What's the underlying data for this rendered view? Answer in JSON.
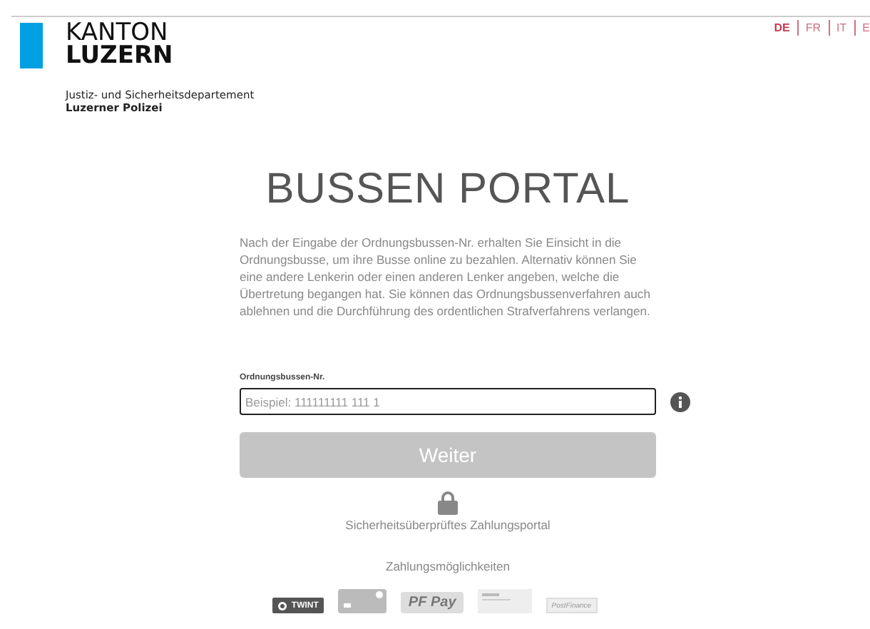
{
  "header": {
    "logo": {
      "line_1": "KANTON",
      "line_2": "LUZERN"
    },
    "department": "Justiz- und Sicherheitsdepartement",
    "unit": "Luzerner Polizei"
  },
  "languages": [
    {
      "label": "DE",
      "selected": true
    },
    {
      "label": "FR",
      "selected": false
    },
    {
      "label": "IT",
      "selected": false
    },
    {
      "label": "E",
      "selected": false
    }
  ],
  "title": "BUSSEN PORTAL",
  "intro": "Nach der Eingabe der Ordnungsbussen-Nr. erhalten Sie Einsicht in die Ordnungsbusse, um ihre Busse online zu bezahlen. Alternativ können Sie eine andere Lenkerin oder einen anderen Lenker angeben, welche die Übertretung begangen hat. Sie können das Ordnungsbussenverfahren auch ablehnen und die Durchführung des ordentlichen Strafverfahrens verlangen.",
  "form": {
    "label": "Ordnungsbussen-Nr.",
    "placeholder": "Beispiel: 111111111 111 1",
    "submit": {
      "label": "Weiter",
      "disabled": true
    }
  },
  "security_note": "Sicherheitsüberprüftes Zahlungsportal",
  "payment_heading": "Zahlungsmöglichkeiten",
  "payment_methods": [
    {
      "kind": "twint",
      "label": "TWINT"
    },
    {
      "kind": "card"
    },
    {
      "kind": "pfpay",
      "label": "PF Pay"
    },
    {
      "kind": "slip"
    },
    {
      "kind": "postfinance",
      "label": "PostFinance"
    }
  ]
}
